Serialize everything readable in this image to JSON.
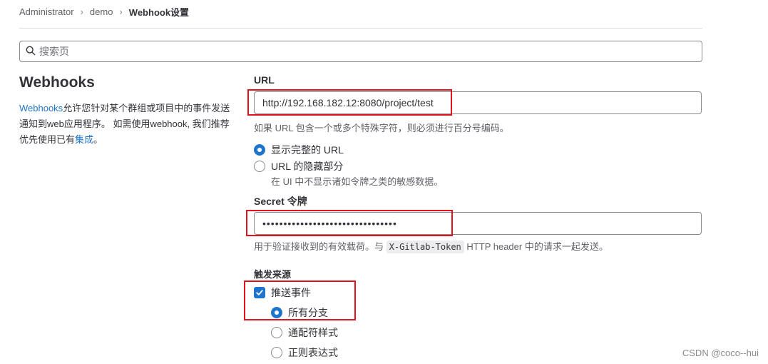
{
  "breadcrumb": {
    "items": [
      "Administrator",
      "demo"
    ],
    "current": "Webhook设置",
    "separator": "›"
  },
  "search": {
    "placeholder": "搜索页",
    "icon": "search-icon"
  },
  "intro": {
    "title": "Webhooks",
    "desc_link": "Webhooks",
    "desc_mid": "允许您针对某个群组或项目中的事件发送通知到web应用程序。 如需使用webhook, 我们推荐优先使用已有",
    "desc_link2": "集成",
    "desc_end": "。"
  },
  "url_section": {
    "label": "URL",
    "value": "http://192.168.182.12:8080/project/test",
    "help": "如果 URL 包含一个或多个特殊字符，则必须进行百分号编码。",
    "option_full": "显示完整的 URL",
    "option_mask": "URL 的隐藏部分",
    "option_mask_help": "在 UI 中不显示诸如令牌之类的敏感数据。",
    "selected": "option_full"
  },
  "secret_section": {
    "label": "Secret 令牌",
    "value": "••••••••••••••••••••••••••••••••",
    "help_before": "用于验证接收到的有效载荷。与",
    "help_code": "X-Gitlab-Token",
    "help_after": "HTTP header 中的请求一起发送。"
  },
  "triggers": {
    "heading": "触发来源",
    "push_events": {
      "label": "推送事件",
      "checked": true
    },
    "branch_options": [
      {
        "label": "所有分支",
        "selected": true
      },
      {
        "label": "通配符样式",
        "selected": false
      },
      {
        "label": "正则表达式",
        "selected": false
      }
    ]
  },
  "watermark": "CSDN @coco--hui",
  "colors": {
    "accent": "#1f75cb",
    "annotation": "#e1141b",
    "text": "#333238"
  }
}
